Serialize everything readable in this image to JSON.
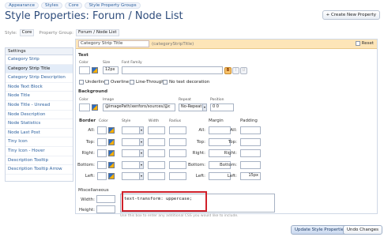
{
  "breadcrumb": [
    "Appearance",
    "Styles",
    "Core",
    "Style Property Groups"
  ],
  "page_title": "Style Properties: Forum / Node List",
  "create_button": "+ Create New Property",
  "filters": {
    "style_label": "Style:",
    "style_value": "Core",
    "group_label": "Property Group:",
    "group_value": "Forum / Node List"
  },
  "sidebar": {
    "header": "Settings",
    "items": [
      "Category Strip",
      "Category Strip Title",
      "Category Strip Description",
      "Node Text Block",
      "Node Title",
      "Node Title - Unread",
      "Node Description",
      "Node Statistics",
      "Node Last Post",
      "Tiny Icon",
      "Tiny Icon - Hover",
      "Description Tooltip",
      "Description Tooltip Arrow"
    ],
    "active_index": 1
  },
  "panel": {
    "title": "Category Strip Title",
    "subtitle": "(categoryStripTitle)",
    "reset_label": "Reset",
    "text_section": "Text",
    "color_label": "Color",
    "size_label": "Size",
    "size_value": "12px",
    "font_family_label": "Font Family",
    "bold": "B",
    "italic": "I",
    "underline_btn": "U",
    "decorations": [
      "Underline",
      "Overline",
      "Line-Through",
      "No text decoration"
    ],
    "background_section": "Background",
    "bg_color_label": "Color",
    "image_label": "Image",
    "image_value": "@imagePath/xenforo/sources/@c",
    "repeat_label": "Repeat",
    "repeat_value": "No-Repeat",
    "position_label": "Position",
    "position_value": "0 0",
    "border_section": "Border",
    "border_color_label": "Color",
    "border_style_label": "Style",
    "border_width_label": "Width",
    "border_radius_label": "Radius",
    "margin_section": "Margin",
    "padding_section": "Padding",
    "sides": [
      "All:",
      "Top:",
      "Right:",
      "Bottom:",
      "Left:"
    ],
    "padding_left_value": "15px",
    "misc_section": "Miscellaneous",
    "width_label": "Width:",
    "height_label": "Height:",
    "css_value": "text-transform: uppercase;",
    "hint": "Use this box to enter any additional CSS you would like to include."
  },
  "footer": {
    "update": "Update Style Properties",
    "undo": "Undo Changes"
  }
}
